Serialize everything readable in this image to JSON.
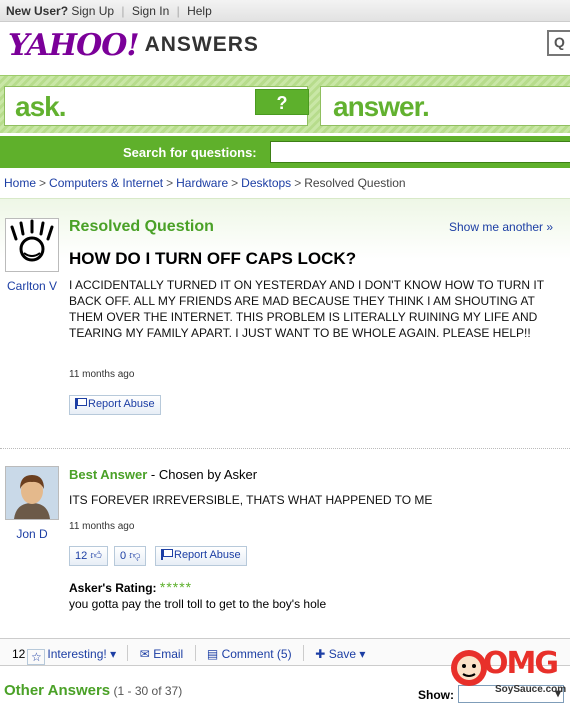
{
  "topbar": {
    "new_user": "New User?",
    "sign_up": "Sign Up",
    "sign_in": "Sign In",
    "help": "Help"
  },
  "logo": {
    "yahoo": "YAHOO!",
    "answers": "ANSWERS"
  },
  "band": {
    "ask": "ask.",
    "answer": "answer.",
    "ask_button": "?"
  },
  "search": {
    "label": "Search for questions:",
    "value": ""
  },
  "breadcrumb": [
    "Home",
    "Computers & Internet",
    "Hardware",
    "Desktops",
    "Resolved Question"
  ],
  "question": {
    "status": "Resolved Question",
    "show_another": "Show me another »",
    "title": "HOW DO I TURN OFF CAPS LOCK?",
    "body": "I ACCIDENTALLY TURNED IT ON YESTERDAY AND I DON'T KNOW HOW TO TURN IT BACK OFF. ALL MY FRIENDS ARE MAD BECAUSE THEY THINK I AM SHOUTING AT THEM OVER THE INTERNET. THIS PROBLEM IS LITERALLY RUINING MY LIFE AND TEARING MY FAMILY APART. I JUST WANT TO BE WHOLE AGAIN. PLEASE HELP!!",
    "asker": "Carlton V",
    "time": "11 months ago",
    "report": "Report Abuse"
  },
  "best_answer": {
    "label": "Best Answer",
    "chosen": " - Chosen by Asker",
    "body": "ITS FOREVER IRREVERSIBLE, THATS WHAT HAPPENED TO ME",
    "user": "Jon D",
    "time": "11 months ago",
    "thumbs_up": "12",
    "thumbs_down": "0",
    "report": "Report Abuse",
    "rating_label": "Asker's Rating:",
    "stars": "*****",
    "rating_comment": "you gotta pay the troll toll to get to the boy's hole"
  },
  "actions": {
    "count": "12",
    "interesting": "Interesting!",
    "email": "Email",
    "comment": "Comment (5)",
    "save": "Save"
  },
  "other": {
    "title": "Other Answers",
    "range": "(1 - 30 of 37)",
    "show_label": "Show:"
  },
  "watermark": {
    "text": "OMG",
    "sub": "SoySauce.com"
  },
  "colors": {
    "green": "#5db02c",
    "purple": "#7b0099",
    "link": "#1c3ea4"
  }
}
